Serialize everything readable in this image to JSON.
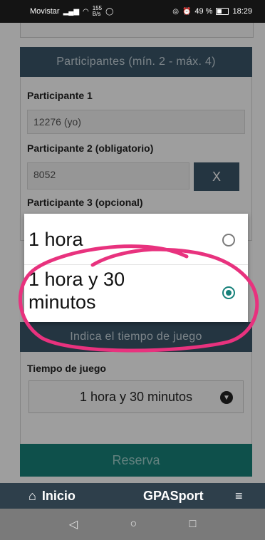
{
  "status_bar": {
    "carrier": "Movistar",
    "speed": "155",
    "speed_unit": "B/s",
    "battery": "49 %",
    "time": "18:29"
  },
  "participants": {
    "header": "Participantes (mín. 2 - máx. 4)",
    "p1_label": "Participante 1",
    "p1_value": "12276 (yo)",
    "p2_label": "Participante 2 (obligatorio)",
    "p2_value": "8052",
    "remove_label": "X",
    "p3_label": "Participante 3 (opcional)"
  },
  "time_section": {
    "header": "Indica el tiempo de juego",
    "label": "Tiempo de juego",
    "selected": "1 hora y 30 minutos"
  },
  "reserve_label": "Reserva",
  "bottom_nav": {
    "home_label": "Inicio",
    "brand": "GPASport"
  },
  "dialog": {
    "options": [
      {
        "label": "1 hora",
        "selected": false
      },
      {
        "label": "1 hora y 30 minutos",
        "selected": true
      }
    ]
  },
  "colors": {
    "header_bg": "#3b5669",
    "accent": "#17817a",
    "annotation": "#e8327e"
  }
}
